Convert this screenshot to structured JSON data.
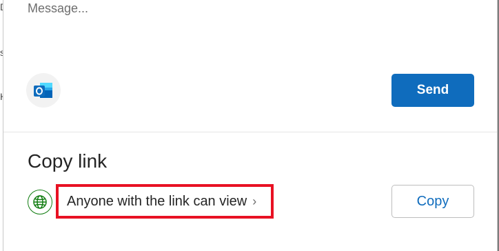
{
  "message": {
    "placeholder": "Message...",
    "value": ""
  },
  "share": {
    "app_icon": "outlook-icon",
    "send_label": "Send"
  },
  "copy_link": {
    "title": "Copy link",
    "icon": "globe-icon",
    "permission_label": "Anyone with the link can view",
    "chevron_icon": "chevron-right-icon",
    "copy_label": "Copy"
  },
  "colors": {
    "primary": "#0f6cbd",
    "highlight_border": "#e81123",
    "globe": "#107c10",
    "overlay": "#7d7d7d"
  }
}
